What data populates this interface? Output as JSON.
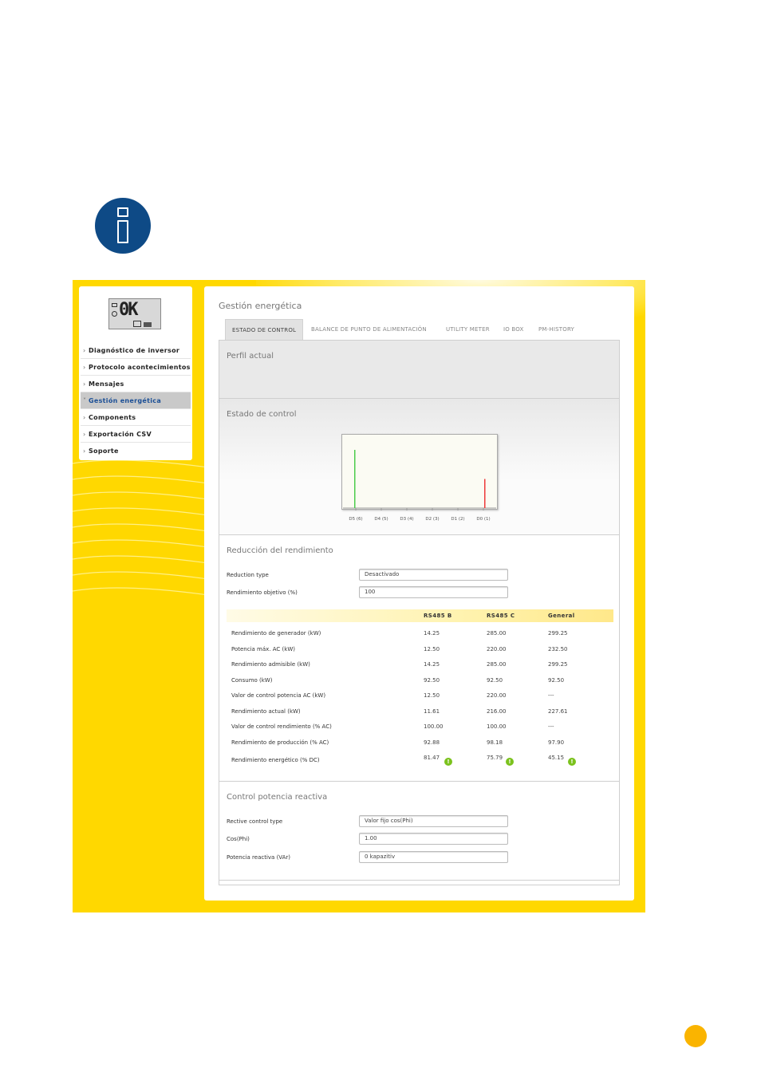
{
  "icons": {
    "info": "info-icon",
    "page_marker": "page-dot-icon"
  },
  "colors": {
    "frame": "#ffd800",
    "info_circle": "#0e4a86",
    "active_menu_text": "#1b4f96",
    "ok_icon": "#7bc21d",
    "page_dot": "#fab400"
  },
  "device": {
    "display_text": "0K"
  },
  "sidebar": {
    "items": [
      {
        "label": "Diagnóstico de inversor",
        "active": false
      },
      {
        "label": "Protocolo acontecimientos",
        "active": false
      },
      {
        "label": "Mensajes",
        "active": false
      },
      {
        "label": "Gestión energética",
        "active": true
      },
      {
        "label": "Components",
        "active": false
      },
      {
        "label": "Exportación CSV",
        "active": false
      },
      {
        "label": "Soporte",
        "active": false
      }
    ]
  },
  "main": {
    "title": "Gestión energética",
    "tabs": [
      {
        "label": "ESTADO DE CONTROL",
        "active": true
      },
      {
        "label": "BALANCE DE PUNTO DE ALIMENTACIÓN",
        "active": false
      },
      {
        "label": "UTILITY METER",
        "active": false
      },
      {
        "label": "IO BOX",
        "active": false
      },
      {
        "label": "PM-HISTORY",
        "active": false
      }
    ],
    "perfil_title": "Perfil actual",
    "estado_title": "Estado de control",
    "reduccion": {
      "title": "Reducción del rendimiento",
      "fields": [
        {
          "label": "Reduction type",
          "value": "Desactivado"
        },
        {
          "label": "Rendimiento objetivo (%)",
          "value": "100"
        }
      ],
      "table": {
        "headers": [
          "",
          "RS485 B",
          "RS485 C",
          "General"
        ],
        "rows": [
          {
            "label": "Rendimiento de generador (kW)",
            "values": [
              "14.25",
              "285.00",
              "299.25"
            ]
          },
          {
            "label": "Potencia máx. AC (kW)",
            "values": [
              "12.50",
              "220.00",
              "232.50"
            ]
          },
          {
            "label": "Rendimiento admisible (kW)",
            "values": [
              "14.25",
              "285.00",
              "299.25"
            ]
          },
          {
            "label": "Consumo (kW)",
            "values": [
              "92.50",
              "92.50",
              "92.50"
            ]
          },
          {
            "label": "Valor de control potencia AC (kW)",
            "values": [
              "12.50",
              "220.00",
              "---"
            ]
          },
          {
            "label": "Rendimiento actual (kW)",
            "values": [
              "11.61",
              "216.00",
              "227.61"
            ]
          },
          {
            "label": "Valor de control rendimiento (% AC)",
            "values": [
              "100.00",
              "100.00",
              "---"
            ]
          },
          {
            "label": "Rendimiento de producción (% AC)",
            "values": [
              "92.88",
              "98.18",
              "97.90"
            ]
          },
          {
            "label": "Rendimiento energético (% DC)",
            "values": [
              "81.47",
              "75.79",
              "45.15"
            ],
            "status_icon": "ok-icon"
          }
        ]
      }
    },
    "reactiva": {
      "title": "Control potencia reactiva",
      "fields": [
        {
          "label": "Rective control type",
          "value": "Valor fijo cos(Phi)"
        },
        {
          "label": "Cos(Phi)",
          "value": "1.00"
        },
        {
          "label": "Potencia reactiva (VAr)",
          "value": "0 kapazitiv"
        }
      ]
    }
  },
  "chart_data": {
    "type": "bar",
    "categories": [
      "D5 (6)",
      "D4 (5)",
      "D3 (4)",
      "D2 (3)",
      "D1 (2)",
      "D0 (1)"
    ],
    "series": [
      {
        "values": [
          100,
          0,
          0,
          0,
          0,
          0
        ],
        "color": "#4ccc4c"
      },
      {
        "values": [
          0,
          0,
          0,
          0,
          0,
          50
        ],
        "color": "#ee3a3a"
      }
    ],
    "ylim": [
      0,
      100
    ],
    "grid": false
  }
}
